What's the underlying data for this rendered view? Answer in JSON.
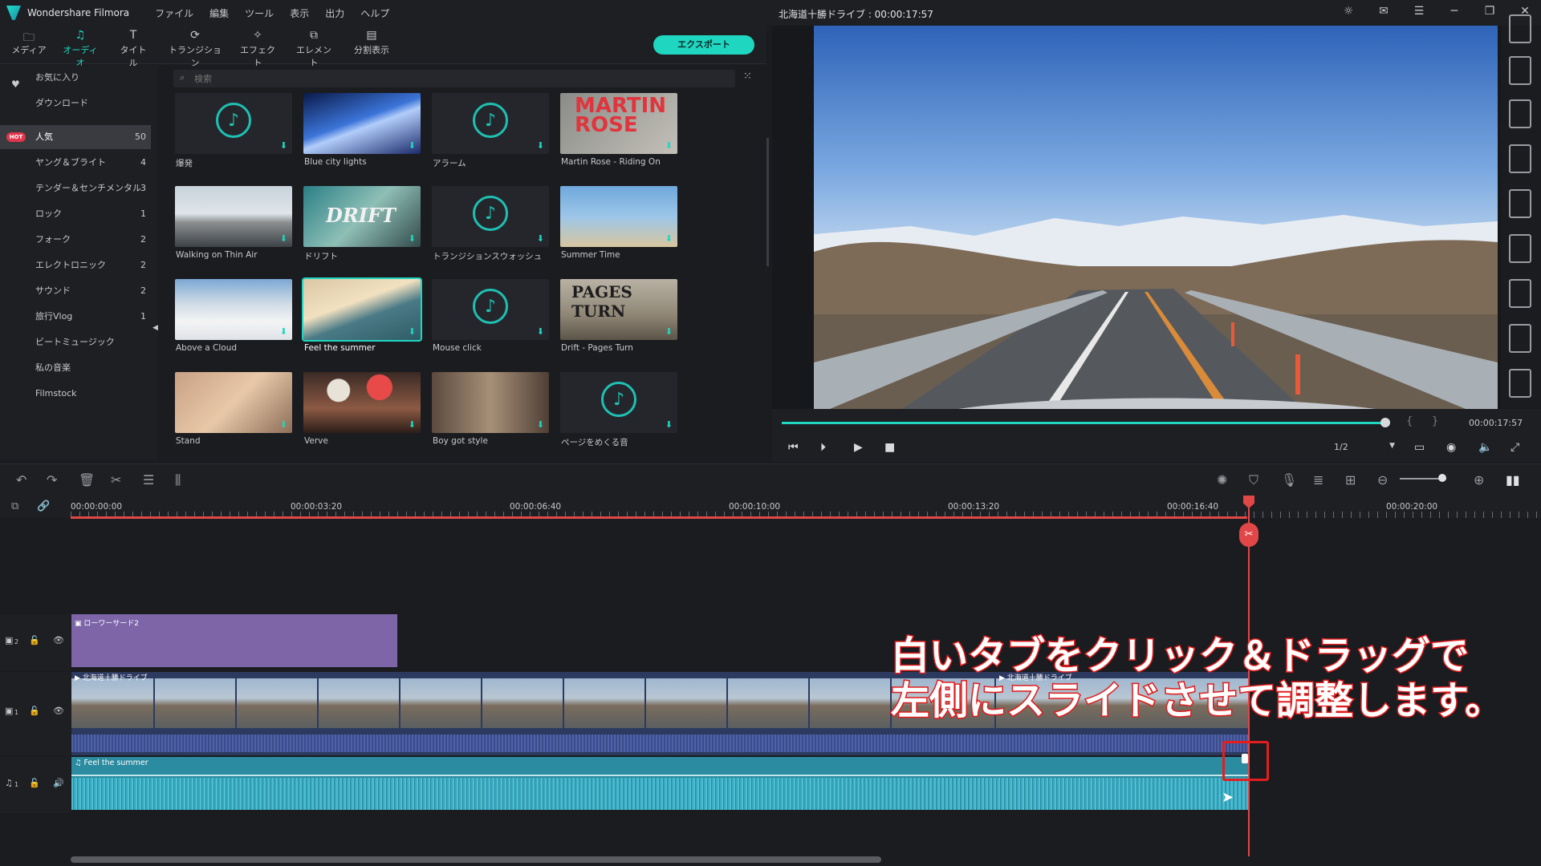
{
  "app": {
    "name": "Wondershare Filmora",
    "doc_title": "北海道十勝ドライブ : 00:00:17:57"
  },
  "menus": [
    "ファイル",
    "編集",
    "ツール",
    "表示",
    "出力",
    "ヘルプ"
  ],
  "toolbar": {
    "tabs": [
      {
        "label": "メディア",
        "icon": "folder-icon"
      },
      {
        "label": "オーディオ",
        "icon": "music-note-icon",
        "active": true
      },
      {
        "label": "タイトル",
        "icon": "text-t-icon"
      },
      {
        "label": "トランジション",
        "icon": "transition-icon"
      },
      {
        "label": "エフェクト",
        "icon": "effect-icon"
      },
      {
        "label": "エレメント",
        "icon": "element-icon"
      },
      {
        "label": "分割表示",
        "icon": "split-screen-icon"
      }
    ],
    "export_label": "エクスポート"
  },
  "categories": [
    {
      "label": "お気に入り",
      "count": ""
    },
    {
      "label": "ダウンロード",
      "count": ""
    },
    {
      "label": "人気",
      "count": "50",
      "selected": true,
      "badge": "HOT"
    },
    {
      "label": "ヤング＆ブライト",
      "count": "4"
    },
    {
      "label": "テンダー＆センチメンタル",
      "count": "3"
    },
    {
      "label": "ロック",
      "count": "1"
    },
    {
      "label": "フォーク",
      "count": "2"
    },
    {
      "label": "エレクトロニック",
      "count": "2"
    },
    {
      "label": "サウンド",
      "count": "2"
    },
    {
      "label": "旅行Vlog",
      "count": "1"
    },
    {
      "label": "ビートミュージック",
      "count": ""
    },
    {
      "label": "私の音楽",
      "count": ""
    },
    {
      "label": "Filmstock",
      "count": ""
    }
  ],
  "search": {
    "placeholder": "検索"
  },
  "grid": [
    {
      "label": "爆発",
      "type": "sound"
    },
    {
      "label": "Blue city lights",
      "type": "music"
    },
    {
      "label": "アラーム",
      "type": "sound"
    },
    {
      "label": "Martin Rose - Riding On",
      "type": "music",
      "thumb_text": "MARTIN ROSE"
    },
    {
      "label": "Walking on Thin Air",
      "type": "music"
    },
    {
      "label": "ドリフト",
      "type": "music",
      "thumb_text": "DRIFT"
    },
    {
      "label": "トランジションスウォッシュ",
      "type": "sound"
    },
    {
      "label": "Summer Time",
      "type": "music"
    },
    {
      "label": "Above a Cloud",
      "type": "music"
    },
    {
      "label": "Feel the summer",
      "type": "music",
      "selected": true
    },
    {
      "label": "Mouse click",
      "type": "sound"
    },
    {
      "label": "Drift - Pages Turn",
      "type": "music",
      "thumb_text": "PAGES TURN"
    },
    {
      "label": "Stand",
      "type": "music"
    },
    {
      "label": "Verve",
      "type": "music"
    },
    {
      "label": "Boy got style",
      "type": "music"
    },
    {
      "label": "ページをめくる音",
      "type": "sound"
    }
  ],
  "player": {
    "timecode": "00:00:17:57",
    "ratio": "1/2",
    "progress": 0.99
  },
  "ruler": [
    "00:00:00:00",
    "00:00:03:20",
    "00:00:06:40",
    "00:00:10:00",
    "00:00:13:20",
    "00:00:16:40",
    "00:00:20:00"
  ],
  "tracks": {
    "title_track": {
      "num": "2",
      "clip": "ローワーサード2"
    },
    "video_track": {
      "num": "1",
      "clip": "北海道十勝ドライブ",
      "clip2": "北海道十勝ドライブ"
    },
    "audio_track": {
      "num": "1",
      "clip": "Feel the summer"
    }
  },
  "annotation": {
    "line1": "白いタブをクリック＆ドラッグで",
    "line2": "左側にスライドさせて調整します。"
  },
  "colors": {
    "accent": "#1fd6c0",
    "playhead": "#e24747",
    "title_clip": "#7d65a8",
    "audio_clip": "#2b8ba0",
    "video_clip": "#2d3a60",
    "annotation": "#e01d1d"
  }
}
